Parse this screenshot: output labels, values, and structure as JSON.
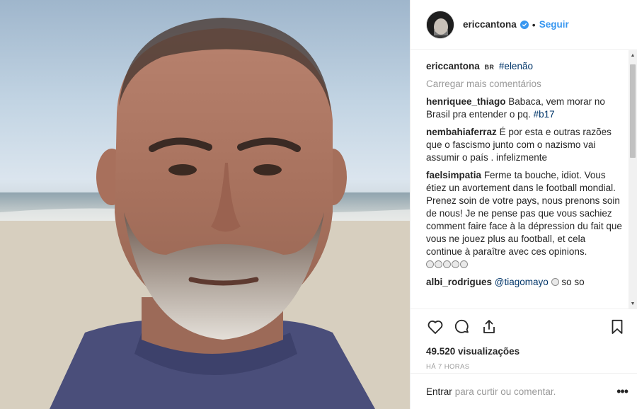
{
  "post": {
    "username": "ericcantona",
    "follow_label": "Seguir",
    "separator": "•"
  },
  "caption": {
    "username": "ericcantona",
    "region_tag": "BR",
    "hashtag": "#elenão"
  },
  "load_more_label": "Carregar mais comentários",
  "comments": [
    {
      "user": "henriquee_thiago",
      "text": "Babaca, vem morar no Brasil pra entender o pq. ",
      "tag": "#b17"
    },
    {
      "user": "nembahiaferraz",
      "text": "É por esta e outras razões que o fascismo junto com o nazismo vai assumir o país . infelizmente"
    },
    {
      "user": "faelsimpatia",
      "text": "Ferme ta bouche, idiot. Vous étiez un avortement dans le football mondial.",
      "text2": "Prenez soin de votre pays, nous prenons soin de nous! Je ne pense pas que vous sachiez comment faire face à la dépression du fait que vous ne jouez plus au football, et cela continue à paraître avec ces opinions.",
      "emojis": [
        "grin-face",
        "grin-face",
        "grin-face",
        "grin-face",
        "grin-face"
      ]
    },
    {
      "user": "albi_rodrigues",
      "mention": "@tiagomayo",
      "emoji": "grin-face",
      "text": "so so"
    }
  ],
  "stats": {
    "views": "49.520 visualizações",
    "time": "HÁ 7 HORAS"
  },
  "footer": {
    "login_link": "Entrar",
    "login_rest": "para curtir ou comentar.",
    "more_glyph": "•••"
  },
  "icons": [
    "heart-icon",
    "comment-icon",
    "share-icon",
    "bookmark-icon",
    "verified-icon",
    "more-options-icon"
  ],
  "colors": {
    "link": "#3897f0",
    "hashtag": "#003569",
    "muted": "#999999",
    "text": "#262626"
  }
}
